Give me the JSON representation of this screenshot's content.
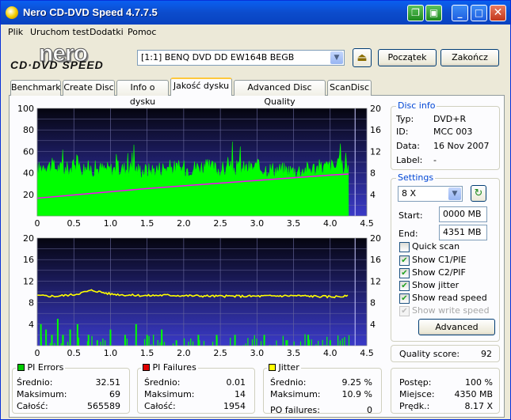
{
  "window": {
    "title": "Nero CD-DVD Speed 4.7.7.5"
  },
  "titlebar_buttons": [
    "minimize",
    "maximize",
    "close"
  ],
  "menu": [
    "Plik",
    "Uruchom test",
    "Dodatki",
    "Pomoc"
  ],
  "logo": {
    "line1": "nero",
    "line2": "CD·DVD SPEED"
  },
  "drive": {
    "value": "[1:1]  BENQ DVD DD EW164B BEGB"
  },
  "buttons": {
    "start": "Początek",
    "end": "Zakończ",
    "advanced": "Advanced"
  },
  "tabs": [
    {
      "label": "Benchmark",
      "active": false
    },
    {
      "label": "Create Disc",
      "active": false
    },
    {
      "label": "Info o dysku",
      "active": false
    },
    {
      "label": "Jakość dysku",
      "active": true
    },
    {
      "label": "Advanced Disc Quality",
      "active": false
    },
    {
      "label": "ScanDisc",
      "active": false
    }
  ],
  "disc_info": {
    "title": "Disc info",
    "rows": [
      {
        "label": "Typ:",
        "value": "DVD+R"
      },
      {
        "label": "ID:",
        "value": "MCC 003"
      },
      {
        "label": "Data:",
        "value": "16 Nov 2007"
      },
      {
        "label": "Label:",
        "value": "-"
      }
    ]
  },
  "settings": {
    "title": "Settings",
    "speed": "8 X",
    "start_label": "Start:",
    "start_value": "0000 MB",
    "end_label": "End:",
    "end_value": "4351 MB",
    "checkboxes": [
      {
        "label": "Quick scan",
        "checked": false,
        "enabled": true
      },
      {
        "label": "Show C1/PIE",
        "checked": true,
        "enabled": true
      },
      {
        "label": "Show C2/PIF",
        "checked": true,
        "enabled": true
      },
      {
        "label": "Show jitter",
        "checked": true,
        "enabled": true
      },
      {
        "label": "Show read speed",
        "checked": true,
        "enabled": true
      },
      {
        "label": "Show write speed",
        "checked": true,
        "enabled": false
      }
    ]
  },
  "quality": {
    "label": "Quality score:",
    "value": "92"
  },
  "pi_errors": {
    "title": "PI Errors",
    "color": "#00cc00",
    "rows": [
      {
        "label": "Średnio:",
        "value": "32.51"
      },
      {
        "label": "Maksimum:",
        "value": "69"
      },
      {
        "label": "Całość:",
        "value": "565589"
      }
    ]
  },
  "pi_failures": {
    "title": "PI Failures",
    "color": "#e00000",
    "rows": [
      {
        "label": "Średnio:",
        "value": "0.01"
      },
      {
        "label": "Maksimum:",
        "value": "14"
      },
      {
        "label": "Całość:",
        "value": "1954"
      }
    ]
  },
  "jitter": {
    "title": "Jitter",
    "color": "#ffff00",
    "rows": [
      {
        "label": "Średnio:",
        "value": "9.25 %"
      },
      {
        "label": "Maksimum:",
        "value": "10.9 %"
      },
      {
        "label": "PO failures:",
        "value": "0"
      }
    ]
  },
  "progress": {
    "rows": [
      {
        "label": "Postęp:",
        "value": "100 %"
      },
      {
        "label": "Miejsce:",
        "value": "4350 MB"
      },
      {
        "label": "Prędk.:",
        "value": "8.17 X"
      }
    ]
  },
  "chart_data": [
    {
      "type": "area",
      "name": "PI Errors / read speed",
      "xlim": [
        0,
        4.5
      ],
      "x_ticks": [
        "0",
        "0.5",
        "1.0",
        "1.5",
        "2.0",
        "2.5",
        "3.0",
        "3.5",
        "4.0",
        "4.5"
      ],
      "ylim_left": [
        0,
        100
      ],
      "y_ticks_left": [
        "20",
        "40",
        "60",
        "80",
        "100"
      ],
      "ylim_right": [
        0,
        20
      ],
      "y_ticks_right": [
        "4",
        "8",
        "12",
        "16",
        "20"
      ],
      "series": [
        {
          "name": "PI Errors",
          "color": "#00ff00",
          "x": [
            0,
            0.1,
            0.2,
            0.3,
            0.4,
            0.5,
            0.75,
            1.0,
            1.25,
            1.5,
            1.75,
            2.0,
            2.25,
            2.5,
            2.75,
            3.0,
            3.25,
            3.5,
            3.75,
            4.0,
            4.25
          ],
          "values": [
            42,
            48,
            46,
            44,
            43,
            45,
            44,
            43,
            44,
            42,
            45,
            44,
            46,
            43,
            44,
            45,
            43,
            42,
            44,
            46,
            45
          ]
        },
        {
          "name": "Read speed",
          "color": "#ff00ff",
          "x": [
            0,
            0.5,
            1.0,
            1.5,
            2.0,
            2.5,
            3.0,
            3.5,
            4.0,
            4.25
          ],
          "values": [
            3.3,
            3.9,
            4.5,
            5.1,
            5.6,
            6.1,
            6.6,
            7.1,
            7.6,
            7.8
          ]
        }
      ]
    },
    {
      "type": "area",
      "name": "PI Failures / jitter",
      "xlim": [
        0,
        4.5
      ],
      "x_ticks": [
        "0",
        "0.5",
        "1.0",
        "1.5",
        "2.0",
        "2.5",
        "3.0",
        "3.5",
        "4.0",
        "4.5"
      ],
      "ylim_left": [
        0,
        20
      ],
      "y_ticks_left": [
        "4",
        "8",
        "12",
        "16",
        "20"
      ],
      "ylim_right": [
        0,
        20
      ],
      "y_ticks_right": [
        "4",
        "8",
        "12",
        "16",
        "20"
      ],
      "series": [
        {
          "name": "PI Failures",
          "color": "#00ff00",
          "x": [
            0.05,
            0.12,
            0.2,
            0.28,
            0.35,
            0.45,
            0.55,
            0.7,
            0.82,
            1.0,
            1.2,
            1.35,
            1.5,
            1.7,
            1.9,
            2.2,
            2.45,
            2.7,
            3.1,
            3.4,
            3.7,
            4.0
          ],
          "values": [
            4,
            3,
            2,
            5,
            2,
            3,
            4,
            2,
            1,
            3,
            2,
            4,
            2,
            3,
            1,
            2,
            2,
            2,
            2,
            1,
            2,
            1
          ]
        },
        {
          "name": "Jitter",
          "color": "#ffff00",
          "x": [
            0,
            0.25,
            0.5,
            0.75,
            1.0,
            1.25,
            1.5,
            1.75,
            2.0,
            2.5,
            3.0,
            3.5,
            4.0,
            4.25
          ],
          "values": [
            9.3,
            9.2,
            9.5,
            10.3,
            9.6,
            9.4,
            9.3,
            9.4,
            9.3,
            9.2,
            9.2,
            9.3,
            9.1,
            9.2
          ]
        }
      ]
    }
  ]
}
